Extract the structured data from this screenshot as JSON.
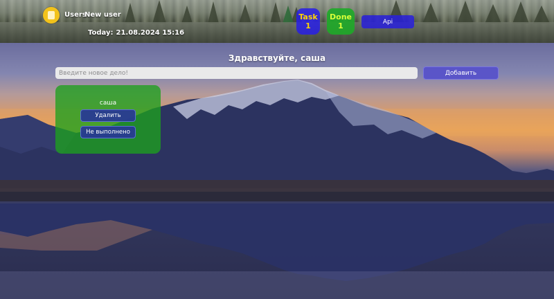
{
  "header": {
    "nav": {
      "users": "Users",
      "new_user": "New user"
    },
    "today_label": "Today:",
    "today_value": "21.08.2024 15:16",
    "counters": {
      "task_label": "Task",
      "task_value": "1",
      "done_label": "Done",
      "done_value": "1"
    },
    "api_label": "Api",
    "logo_icon": "note-icon"
  },
  "main": {
    "greeting": "Здравствуйте, саша",
    "input_placeholder": "Введите новое дело!",
    "add_label": "Добавить",
    "tasks": [
      {
        "text": "саша",
        "delete_label": "Удалить",
        "status_label": "Не выполнено"
      }
    ]
  },
  "colors": {
    "task_counter": "#2a1fe6",
    "done_counter": "#1eaa28",
    "task_card": "#1ea01e",
    "add_button": "#5a55c8",
    "logo": "#f2c21b"
  }
}
